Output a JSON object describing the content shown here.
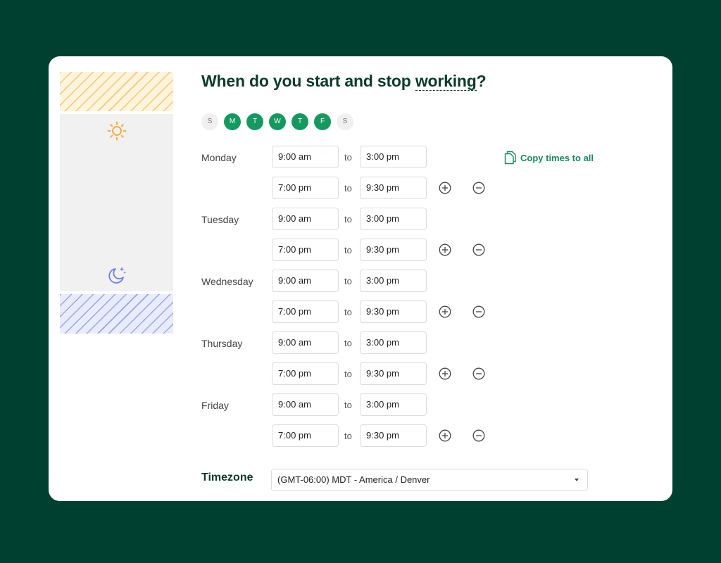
{
  "title": {
    "before": "When do you start and stop ",
    "emphasis": "working",
    "after": "?"
  },
  "weekdays": [
    {
      "letter": "S",
      "selected": false
    },
    {
      "letter": "M",
      "selected": true
    },
    {
      "letter": "T",
      "selected": true
    },
    {
      "letter": "W",
      "selected": true
    },
    {
      "letter": "T",
      "selected": true
    },
    {
      "letter": "F",
      "selected": true
    },
    {
      "letter": "S",
      "selected": false
    }
  ],
  "schedule": [
    {
      "day": "Monday",
      "slots": [
        {
          "start": "9:00 am",
          "end": "3:00 pm"
        },
        {
          "start": "7:00 pm",
          "end": "9:30 pm"
        }
      ]
    },
    {
      "day": "Tuesday",
      "slots": [
        {
          "start": "9:00 am",
          "end": "3:00 pm"
        },
        {
          "start": "7:00 pm",
          "end": "9:30 pm"
        }
      ]
    },
    {
      "day": "Wednesday",
      "slots": [
        {
          "start": "9:00 am",
          "end": "3:00 pm"
        },
        {
          "start": "7:00 pm",
          "end": "9:30 pm"
        }
      ]
    },
    {
      "day": "Thursday",
      "slots": [
        {
          "start": "9:00 am",
          "end": "3:00 pm"
        },
        {
          "start": "7:00 pm",
          "end": "9:30 pm"
        }
      ]
    },
    {
      "day": "Friday",
      "slots": [
        {
          "start": "9:00 am",
          "end": "3:00 pm"
        },
        {
          "start": "7:00 pm",
          "end": "9:30 pm"
        }
      ]
    }
  ],
  "to_label": "to",
  "copy_label": "Copy times to all",
  "timezone": {
    "label": "Timezone",
    "value": "(GMT-06:00) MDT - America / Denver"
  },
  "icons": {
    "day": "sun-icon",
    "night": "moon-icon",
    "copy": "copy-icon",
    "add": "plus-circle-icon",
    "remove": "minus-circle-icon",
    "dropdown": "caret-down-icon"
  },
  "colors": {
    "background": "#004030",
    "accent": "#159960",
    "heading": "#0b3a2c"
  }
}
